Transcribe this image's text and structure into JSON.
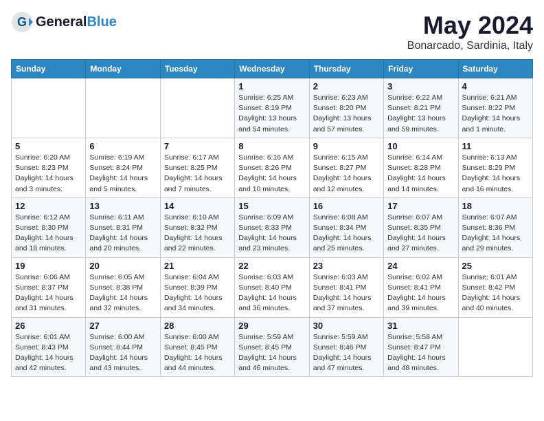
{
  "header": {
    "logo_general": "General",
    "logo_blue": "Blue",
    "month_year": "May 2024",
    "location": "Bonarcado, Sardinia, Italy"
  },
  "weekdays": [
    "Sunday",
    "Monday",
    "Tuesday",
    "Wednesday",
    "Thursday",
    "Friday",
    "Saturday"
  ],
  "weeks": [
    [
      {
        "day": "",
        "info": ""
      },
      {
        "day": "",
        "info": ""
      },
      {
        "day": "",
        "info": ""
      },
      {
        "day": "1",
        "info": "Sunrise: 6:25 AM\nSunset: 8:19 PM\nDaylight: 13 hours\nand 54 minutes."
      },
      {
        "day": "2",
        "info": "Sunrise: 6:23 AM\nSunset: 8:20 PM\nDaylight: 13 hours\nand 57 minutes."
      },
      {
        "day": "3",
        "info": "Sunrise: 6:22 AM\nSunset: 8:21 PM\nDaylight: 13 hours\nand 59 minutes."
      },
      {
        "day": "4",
        "info": "Sunrise: 6:21 AM\nSunset: 8:22 PM\nDaylight: 14 hours\nand 1 minute."
      }
    ],
    [
      {
        "day": "5",
        "info": "Sunrise: 6:20 AM\nSunset: 8:23 PM\nDaylight: 14 hours\nand 3 minutes."
      },
      {
        "day": "6",
        "info": "Sunrise: 6:19 AM\nSunset: 8:24 PM\nDaylight: 14 hours\nand 5 minutes."
      },
      {
        "day": "7",
        "info": "Sunrise: 6:17 AM\nSunset: 8:25 PM\nDaylight: 14 hours\nand 7 minutes."
      },
      {
        "day": "8",
        "info": "Sunrise: 6:16 AM\nSunset: 8:26 PM\nDaylight: 14 hours\nand 10 minutes."
      },
      {
        "day": "9",
        "info": "Sunrise: 6:15 AM\nSunset: 8:27 PM\nDaylight: 14 hours\nand 12 minutes."
      },
      {
        "day": "10",
        "info": "Sunrise: 6:14 AM\nSunset: 8:28 PM\nDaylight: 14 hours\nand 14 minutes."
      },
      {
        "day": "11",
        "info": "Sunrise: 6:13 AM\nSunset: 8:29 PM\nDaylight: 14 hours\nand 16 minutes."
      }
    ],
    [
      {
        "day": "12",
        "info": "Sunrise: 6:12 AM\nSunset: 8:30 PM\nDaylight: 14 hours\nand 18 minutes."
      },
      {
        "day": "13",
        "info": "Sunrise: 6:11 AM\nSunset: 8:31 PM\nDaylight: 14 hours\nand 20 minutes."
      },
      {
        "day": "14",
        "info": "Sunrise: 6:10 AM\nSunset: 8:32 PM\nDaylight: 14 hours\nand 22 minutes."
      },
      {
        "day": "15",
        "info": "Sunrise: 6:09 AM\nSunset: 8:33 PM\nDaylight: 14 hours\nand 23 minutes."
      },
      {
        "day": "16",
        "info": "Sunrise: 6:08 AM\nSunset: 8:34 PM\nDaylight: 14 hours\nand 25 minutes."
      },
      {
        "day": "17",
        "info": "Sunrise: 6:07 AM\nSunset: 8:35 PM\nDaylight: 14 hours\nand 27 minutes."
      },
      {
        "day": "18",
        "info": "Sunrise: 6:07 AM\nSunset: 8:36 PM\nDaylight: 14 hours\nand 29 minutes."
      }
    ],
    [
      {
        "day": "19",
        "info": "Sunrise: 6:06 AM\nSunset: 8:37 PM\nDaylight: 14 hours\nand 31 minutes."
      },
      {
        "day": "20",
        "info": "Sunrise: 6:05 AM\nSunset: 8:38 PM\nDaylight: 14 hours\nand 32 minutes."
      },
      {
        "day": "21",
        "info": "Sunrise: 6:04 AM\nSunset: 8:39 PM\nDaylight: 14 hours\nand 34 minutes."
      },
      {
        "day": "22",
        "info": "Sunrise: 6:03 AM\nSunset: 8:40 PM\nDaylight: 14 hours\nand 36 minutes."
      },
      {
        "day": "23",
        "info": "Sunrise: 6:03 AM\nSunset: 8:41 PM\nDaylight: 14 hours\nand 37 minutes."
      },
      {
        "day": "24",
        "info": "Sunrise: 6:02 AM\nSunset: 8:41 PM\nDaylight: 14 hours\nand 39 minutes."
      },
      {
        "day": "25",
        "info": "Sunrise: 6:01 AM\nSunset: 8:42 PM\nDaylight: 14 hours\nand 40 minutes."
      }
    ],
    [
      {
        "day": "26",
        "info": "Sunrise: 6:01 AM\nSunset: 8:43 PM\nDaylight: 14 hours\nand 42 minutes."
      },
      {
        "day": "27",
        "info": "Sunrise: 6:00 AM\nSunset: 8:44 PM\nDaylight: 14 hours\nand 43 minutes."
      },
      {
        "day": "28",
        "info": "Sunrise: 6:00 AM\nSunset: 8:45 PM\nDaylight: 14 hours\nand 44 minutes."
      },
      {
        "day": "29",
        "info": "Sunrise: 5:59 AM\nSunset: 8:45 PM\nDaylight: 14 hours\nand 46 minutes."
      },
      {
        "day": "30",
        "info": "Sunrise: 5:59 AM\nSunset: 8:46 PM\nDaylight: 14 hours\nand 47 minutes."
      },
      {
        "day": "31",
        "info": "Sunrise: 5:58 AM\nSunset: 8:47 PM\nDaylight: 14 hours\nand 48 minutes."
      },
      {
        "day": "",
        "info": ""
      }
    ]
  ]
}
